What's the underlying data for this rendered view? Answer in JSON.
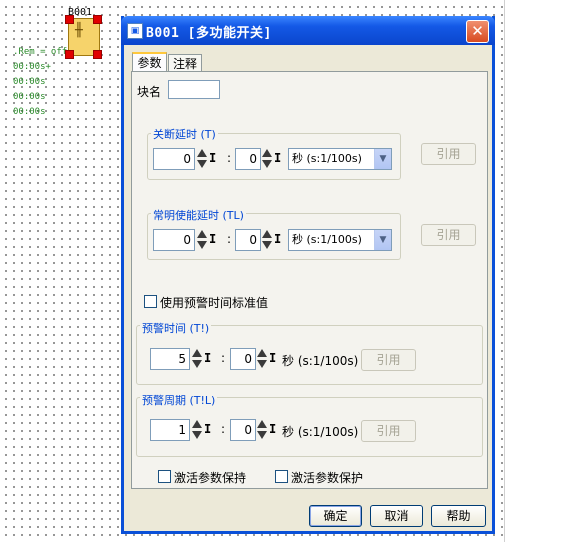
{
  "canvas": {
    "block_label": "B001",
    "block_symbol": "╫",
    "rem_lines": [
      ".Rem = off",
      "00:00s+",
      "00:00s",
      "00:00s",
      "00:00s"
    ]
  },
  "dialog": {
    "title": "B001 [多功能开关]",
    "close_symbol": "✕",
    "tabs": [
      "参数",
      "注释"
    ],
    "block_name_label": "块名",
    "block_name_value": "",
    "off_delay": {
      "label": "关断延时 (T)",
      "value_left": "0",
      "value_right": "0",
      "unit_select": "秒 (s:1/100s)",
      "ref_button": "引用"
    },
    "permanent_light": {
      "label": "常明使能延时 (TL)",
      "value_left": "0",
      "value_right": "0",
      "unit_select": "秒 (s:1/100s)",
      "ref_button": "引用"
    },
    "use_warning_default": "使用预警时间标准值",
    "warning_time": {
      "label": "预警时间 (T!)",
      "value_left": "5",
      "value_right": "0",
      "unit": "秒 (s:1/100s)",
      "ref_button": "引用"
    },
    "warning_period": {
      "label": "预警周期 (T!L)",
      "value_left": "1",
      "value_right": "0",
      "unit": "秒 (s:1/100s)",
      "ref_button": "引用"
    },
    "retentive": "激活参数保持",
    "protection": "激活参数保护",
    "ok": "确定",
    "cancel": "取消",
    "help": "帮助",
    "i_symbol": "I",
    "colon": ":"
  }
}
